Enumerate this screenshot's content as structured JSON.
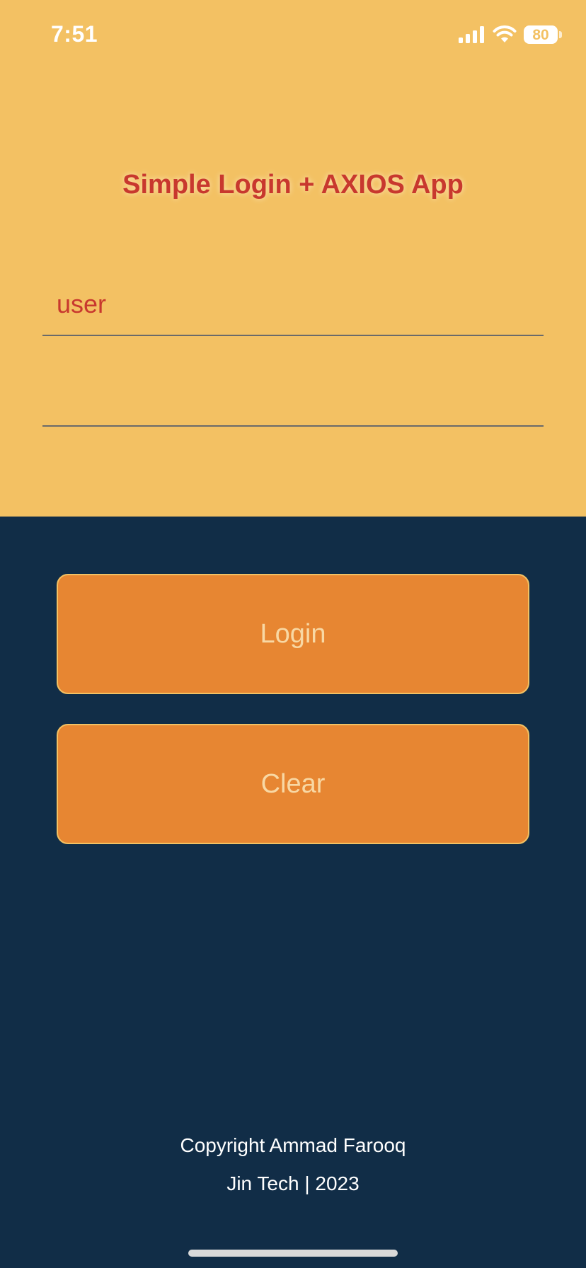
{
  "status_bar": {
    "time": "7:51",
    "battery": "80",
    "icons": [
      "cellular-signal-icon",
      "wifi-icon",
      "battery-icon"
    ]
  },
  "header": {
    "title": "Simple Login + AXIOS App"
  },
  "form": {
    "username_value": "user",
    "password_value": ""
  },
  "buttons": {
    "login_label": "Login",
    "clear_label": "Clear"
  },
  "footer": {
    "line1": "Copyright Ammad Farooq",
    "line2": "Jin Tech | 2023"
  },
  "colors": {
    "top_background": "#F3C163",
    "bottom_background": "#112D47",
    "accent_red": "#C8382E",
    "button_orange": "#E78632",
    "button_text": "#F8D8A4"
  }
}
